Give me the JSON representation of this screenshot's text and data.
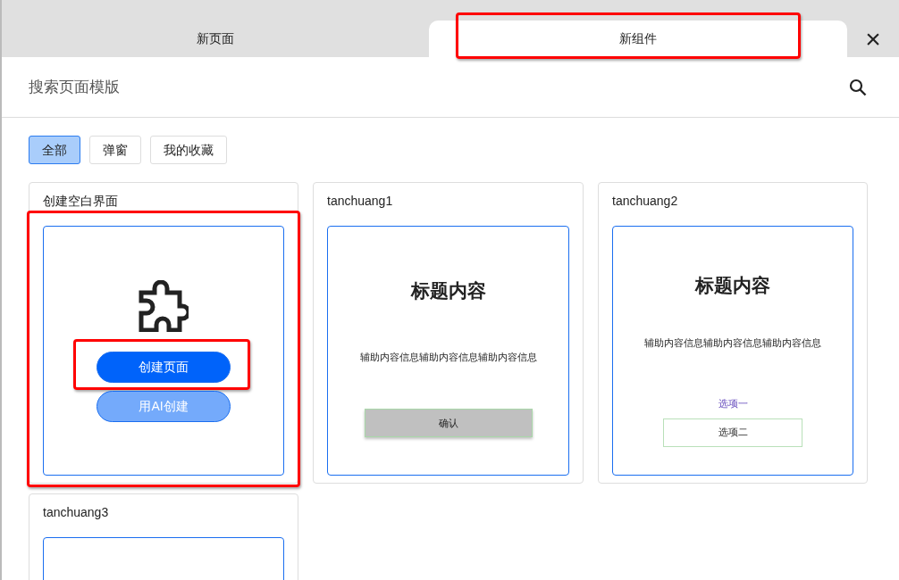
{
  "tabs": [
    {
      "label": "新页面",
      "selected": false,
      "highlighted": false
    },
    {
      "label": "新组件",
      "selected": true,
      "highlighted": true
    }
  ],
  "close": "×",
  "search": {
    "placeholder": "搜索页面模版"
  },
  "filters": [
    {
      "label": "全部",
      "selected": true
    },
    {
      "label": "弹窗",
      "selected": false
    },
    {
      "label": "我的收藏",
      "selected": false
    }
  ],
  "cards": [
    {
      "kind": "blank",
      "title": "创建空白界面",
      "highlighted": true,
      "buttons": [
        {
          "label": "创建页面",
          "primary": true,
          "highlighted": true
        },
        {
          "label": "用AI创建",
          "primary": false
        }
      ]
    },
    {
      "kind": "confirm",
      "title": "tanchuang1",
      "highlighted": false,
      "heading": "标题内容",
      "body": "辅助内容信息辅助内容信息辅助内容信息",
      "button": "确认"
    },
    {
      "kind": "options",
      "title": "tanchuang2",
      "highlighted": false,
      "heading": "标题内容",
      "body": "辅助内容信息辅助内容信息辅助内容信息",
      "option_link": "选项一",
      "option_button": "选项二"
    },
    {
      "kind": "empty",
      "title": "tanchuang3",
      "highlighted": false
    }
  ]
}
